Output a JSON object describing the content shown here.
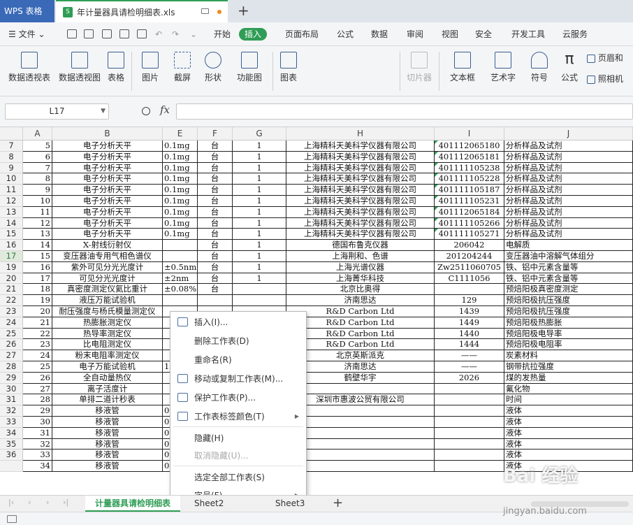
{
  "titlebar": {
    "app_name": "WPS 表格",
    "file_name": "年计量器具请检明细表.xls",
    "new_tab": "+"
  },
  "menubar": {
    "file_label": "文件",
    "items": [
      "开始",
      "插入",
      "页面布局",
      "公式",
      "数据",
      "审阅",
      "视图",
      "安全",
      "开发工具",
      "云服务"
    ],
    "active": "插入",
    "accent_color": "#2f9d55"
  },
  "ribbon": {
    "buttons": [
      "数据透视表",
      "数据透视图",
      "表格",
      "图片",
      "截屏",
      "形状",
      "功能图",
      "图表",
      "切片器",
      "文本框",
      "艺术字",
      "符号",
      "公式",
      "页眉和",
      "照相机"
    ]
  },
  "formula_bar": {
    "cell_ref": "L17",
    "fx": "fx",
    "formula": ""
  },
  "grid": {
    "columns": [
      "A",
      "B",
      "E",
      "F",
      "G",
      "H",
      "I",
      "J"
    ],
    "rows": [
      {
        "n": "7",
        "a": "5",
        "b": "电子分析天平",
        "e": "0.1mg",
        "f": "台",
        "g": "1",
        "h": "上海精科天美科学仪器有限公司",
        "i": "401112065180",
        "j": "分析样品及试剂",
        "tri": true
      },
      {
        "n": "8",
        "a": "6",
        "b": "电子分析天平",
        "e": "0.1mg",
        "f": "台",
        "g": "1",
        "h": "上海精科天美科学仪器有限公司",
        "i": "401112065181",
        "j": "分析样品及试剂",
        "tri": true
      },
      {
        "n": "9",
        "a": "7",
        "b": "电子分析天平",
        "e": "0.1mg",
        "f": "台",
        "g": "1",
        "h": "上海精科天美科学仪器有限公司",
        "i": "401111105238",
        "j": "分析样品及试剂",
        "tri": true
      },
      {
        "n": "10",
        "a": "8",
        "b": "电子分析天平",
        "e": "0.1mg",
        "f": "台",
        "g": "1",
        "h": "上海精科天美科学仪器有限公司",
        "i": "401111105228",
        "j": "分析样品及试剂",
        "tri": true
      },
      {
        "n": "11",
        "a": "9",
        "b": "电子分析天平",
        "e": "0.1mg",
        "f": "台",
        "g": "1",
        "h": "上海精科天美科学仪器有限公司",
        "i": "401111105187",
        "j": "分析样品及试剂",
        "tri": true
      },
      {
        "n": "12",
        "a": "10",
        "b": "电子分析天平",
        "e": "0.1mg",
        "f": "台",
        "g": "1",
        "h": "上海精科天美科学仪器有限公司",
        "i": "401111105231",
        "j": "分析样品及试剂",
        "tri": true
      },
      {
        "n": "13",
        "a": "11",
        "b": "电子分析天平",
        "e": "0.1mg",
        "f": "台",
        "g": "1",
        "h": "上海精科天美科学仪器有限公司",
        "i": "401112065184",
        "j": "分析样品及试剂",
        "tri": true
      },
      {
        "n": "14",
        "a": "12",
        "b": "电子分析天平",
        "e": "0.1mg",
        "f": "台",
        "g": "1",
        "h": "上海精科天美科学仪器有限公司",
        "i": "401111105266",
        "j": "分析样品及试剂",
        "tri": true
      },
      {
        "n": "15",
        "a": "13",
        "b": "电子分析天平",
        "e": "0.1mg",
        "f": "台",
        "g": "1",
        "h": "上海精科天美科学仪器有限公司",
        "i": "401111105271",
        "j": "分析样品及试剂",
        "tri": true
      },
      {
        "n": "16",
        "a": "14",
        "b": "X-射线衍射仪",
        "e": "",
        "f": "台",
        "g": "1",
        "h": "德国布鲁克仪器",
        "i": "206042",
        "j": "电解质"
      },
      {
        "n": "17",
        "a": "15",
        "b": "变压器油专用气相色谱仪",
        "e": "",
        "f": "台",
        "g": "1",
        "h": "上海荆和、色谱",
        "i": "201204244",
        "j": "变压器油中溶解气体组分"
      },
      {
        "n": "19",
        "a": "16",
        "b": "紫外可见分光光度计",
        "e": "±0.5nm",
        "f": "台",
        "g": "1",
        "h": "上海光谱仪器",
        "i": "Zw2511060705",
        "j": "铁、铝中元素含量等"
      },
      {
        "n": "20",
        "a": "17",
        "b": "可见分光光度计",
        "e": "±2nm",
        "f": "台",
        "g": "1",
        "h": "上海菁华科技",
        "i": "C1111056",
        "j": "铁、铝中元素含量等"
      },
      {
        "n": "21",
        "a": "18",
        "b": "真密度测定仪氦比重计",
        "e": "±0.08%",
        "f": "台",
        "g": "",
        "h": "北京比奥得",
        "i": "",
        "j": "预焙阳极真密度测定"
      },
      {
        "n": "22",
        "a": "19",
        "b": "液压万能试验机",
        "e": "",
        "f": "",
        "g": "",
        "h": "济南思达",
        "i": "129",
        "j": "预焙阳极抗压强度"
      },
      {
        "n": "23",
        "a": "20",
        "b": "耐压强度与杨氏模量测定仪",
        "e": "",
        "f": "",
        "g": "",
        "h": "R&D Carbon Ltd",
        "i": "1439",
        "j": "预焙阳极抗压强度"
      },
      {
        "n": "24",
        "a": "21",
        "b": "热膨胀测定仪",
        "e": "",
        "f": "",
        "g": "",
        "h": "R&D Carbon Ltd",
        "i": "1449",
        "j": "预焙阳极热膨胀"
      },
      {
        "n": "25",
        "a": "22",
        "b": "热导率测定仪",
        "e": "",
        "f": "",
        "g": "",
        "h": "R&D Carbon Ltd",
        "i": "1440",
        "j": "预焙阳极电导率"
      },
      {
        "n": "26",
        "a": "23",
        "b": "比电阻测定仪",
        "e": "",
        "f": "",
        "g": "",
        "h": "R&D Carbon Ltd",
        "i": "1444",
        "j": "预焙阳极电阻率"
      },
      {
        "n": "27",
        "a": "24",
        "b": "粉末电阻率测定仪",
        "e": "",
        "f": "",
        "g": "",
        "h": "北京英斯派克",
        "i": "——",
        "j": "炭素材料"
      },
      {
        "n": "28",
        "a": "25",
        "b": "电子万能试验机",
        "e": "1",
        "f": "",
        "g": "",
        "h": "济南思达",
        "i": "——",
        "j": "钢带抗拉强度"
      },
      {
        "n": "29",
        "a": "26",
        "b": "全自动量热仪",
        "e": "",
        "f": "",
        "g": "",
        "h": "鹤壁华宇",
        "i": "2026",
        "j": "煤的发热量"
      },
      {
        "n": "30",
        "a": "27",
        "b": "离子活度计",
        "e": "",
        "f": "",
        "g": "",
        "h": "",
        "i": "",
        "j": "氟化物"
      },
      {
        "n": "31",
        "a": "28",
        "b": "单排二道计秒表",
        "e": "",
        "f": "",
        "g": "",
        "h": "深圳市惠波公贸有限公司",
        "i": "",
        "j": "时间"
      },
      {
        "n": "32",
        "a": "29",
        "b": "移液管",
        "e": "0",
        "f": "",
        "g": "",
        "h": "",
        "i": "",
        "j": "液体"
      },
      {
        "n": "33",
        "a": "30",
        "b": "移液管",
        "e": "0",
        "f": "",
        "g": "",
        "h": "",
        "i": "",
        "j": "液体"
      },
      {
        "n": "34",
        "a": "31",
        "b": "移液管",
        "e": "0",
        "f": "",
        "g": "",
        "h": "",
        "i": "",
        "j": "液体"
      },
      {
        "n": "35",
        "a": "32",
        "b": "移液管",
        "e": "0",
        "f": "",
        "g": "",
        "h": "",
        "i": "",
        "j": "液体"
      },
      {
        "n": "36",
        "a": "33",
        "b": "移液管",
        "e": "0",
        "f": "",
        "g": "",
        "h": "",
        "i": "",
        "j": "液体"
      },
      {
        "n": "",
        "a": "34",
        "b": "移液管",
        "e": "0",
        "f": "",
        "g": "",
        "h": "",
        "i": "",
        "j": "液体"
      }
    ],
    "selected_row": "17"
  },
  "context_menu": {
    "items": [
      {
        "label": "插入(I)...",
        "icon": "insert-sheet-icon",
        "disabled": false,
        "submenu": false
      },
      {
        "label": "删除工作表(D)",
        "icon": "",
        "disabled": false,
        "submenu": false
      },
      {
        "label": "重命名(R)",
        "icon": "",
        "disabled": false,
        "submenu": false
      },
      {
        "label": "移动或复制工作表(M)...",
        "icon": "move-copy-icon",
        "disabled": false,
        "submenu": false
      },
      {
        "label": "保护工作表(P)...",
        "icon": "protect-sheet-icon",
        "disabled": false,
        "submenu": false
      },
      {
        "label": "工作表标签颜色(T)",
        "icon": "tab-color-icon",
        "disabled": false,
        "submenu": true
      },
      {
        "label": "隐藏(H)",
        "icon": "",
        "disabled": false,
        "submenu": false
      },
      {
        "label": "取消隐藏(U)...",
        "icon": "",
        "disabled": true,
        "submenu": false
      },
      {
        "label": "选定全部工作表(S)",
        "icon": "",
        "disabled": false,
        "submenu": false
      },
      {
        "label": "字号(F)",
        "icon": "",
        "disabled": false,
        "submenu": true
      }
    ],
    "highlight_color": "#d6262d"
  },
  "sheet_tabs": {
    "tabs": [
      "计量器具请检明细表",
      "Sheet2",
      "Sheet3"
    ],
    "active": "计量器具请检明细表",
    "add": "+"
  },
  "watermark": {
    "brand": "Bai 经验",
    "url": "jingyan.baidu.com"
  }
}
